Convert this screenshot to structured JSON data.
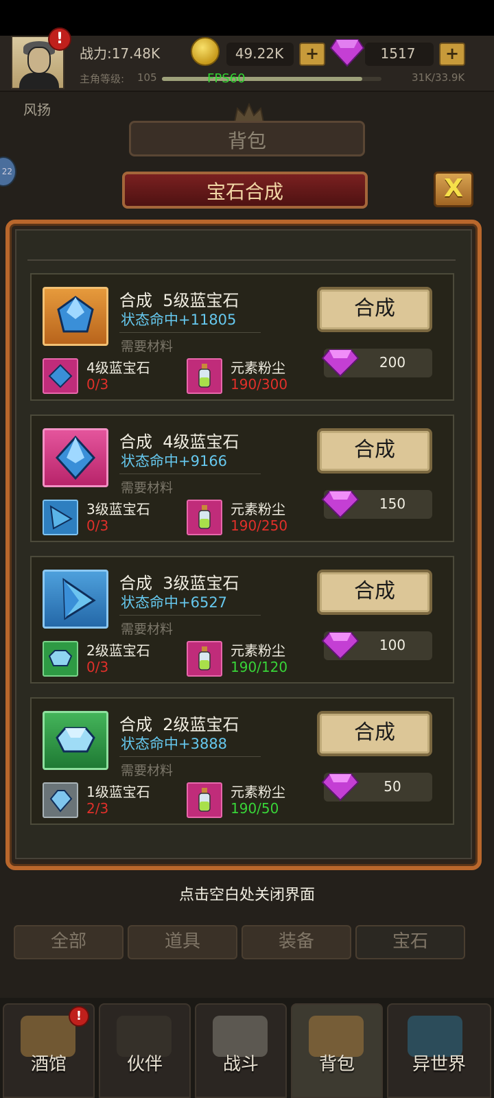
{
  "hud": {
    "power": "战力:17.48K",
    "coins": "49.22K",
    "gems": "1517",
    "plus_label": "+",
    "alert": "!",
    "level_label": "主角等级:",
    "level_value": "105",
    "exp_text": "31K/33.9K",
    "exp_progress": 0.914,
    "fps": "FPS60"
  },
  "background": {
    "player_name": "风扬",
    "bag_title": "背包",
    "side_badge": "22"
  },
  "modal": {
    "title": "宝石合成",
    "close_label": "X",
    "close_hint": "点击空白处关闭界面",
    "need_materials": "需要材料",
    "craft_label": "合成",
    "recipes": [
      {
        "title": "合成  5级蓝宝石",
        "stat": "状态命中+11805",
        "mat1_name": "4级蓝宝石",
        "mat1_count": "0/3",
        "mat2_name": "元素粉尘",
        "mat2_count": "190/300",
        "cost": "200"
      },
      {
        "title": "合成  4级蓝宝石",
        "stat": "状态命中+9166",
        "mat1_name": "3级蓝宝石",
        "mat1_count": "0/3",
        "mat2_name": "元素粉尘",
        "mat2_count": "190/250",
        "cost": "150"
      },
      {
        "title": "合成  3级蓝宝石",
        "stat": "状态命中+6527",
        "mat1_name": "2级蓝宝石",
        "mat1_count": "0/3",
        "mat2_name": "元素粉尘",
        "mat2_count": "190/120",
        "cost": "100"
      },
      {
        "title": "合成  2级蓝宝石",
        "stat": "状态命中+3888",
        "mat1_name": "1级蓝宝石",
        "mat1_count": "2/3",
        "mat2_name": "元素粉尘",
        "mat2_count": "190/50",
        "cost": "50"
      }
    ]
  },
  "categories": [
    "全部",
    "道具",
    "装备",
    "宝石"
  ],
  "nav": [
    "酒馆",
    "伙伴",
    "战斗",
    "背包",
    "异世界"
  ],
  "colors": {
    "insufficient": "#e0302a",
    "sufficient": "#38d438",
    "stat_blue": "#66c8ee",
    "frame_orange": "#b9672c"
  }
}
